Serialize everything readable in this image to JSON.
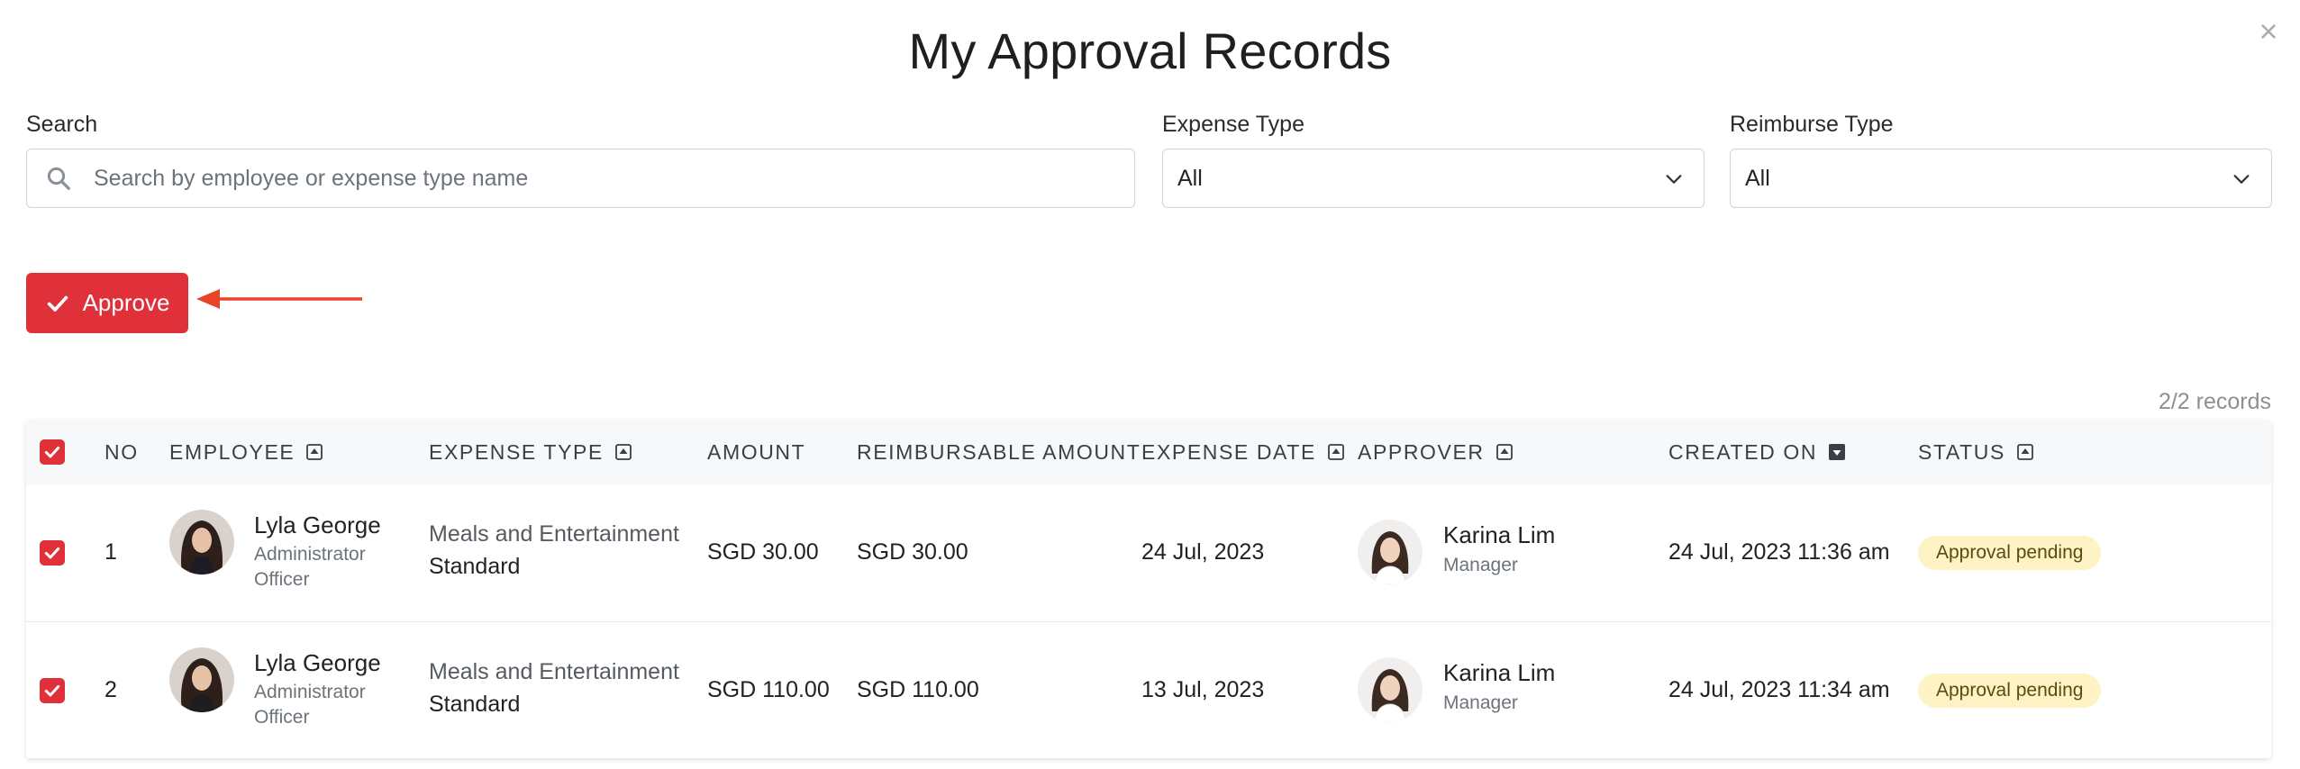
{
  "page": {
    "title": "My Approval Records",
    "close_icon": "close-icon"
  },
  "filters": {
    "search_label": "Search",
    "search_placeholder": "Search by employee or expense type name",
    "search_value": "",
    "expense_type_label": "Expense Type",
    "expense_type_value": "All",
    "reimburse_type_label": "Reimburse Type",
    "reimburse_type_value": "All"
  },
  "toolbar": {
    "approve_label": "Approve",
    "records_count": "2/2 records"
  },
  "table": {
    "headers": {
      "no": "NO",
      "employee": "EMPLOYEE",
      "expense_type": "EXPENSE TYPE",
      "amount": "AMOUNT",
      "reimbursable_amount": "REIMBURSABLE AMOUNT",
      "expense_date": "EXPENSE DATE",
      "approver": "APPROVER",
      "created_on": "CREATED ON",
      "status": "STATUS"
    },
    "select_all_checked": true,
    "rows": [
      {
        "checked": true,
        "no": "1",
        "employee_name": "Lyla George",
        "employee_role_line1": "Administrator",
        "employee_role_line2": "Officer",
        "expense_type": "Meals and Entertainment",
        "expense_subtype": "Standard",
        "amount": "SGD 30.00",
        "reimbursable_amount": "SGD 30.00",
        "expense_date": "24 Jul, 2023",
        "approver_name": "Karina Lim",
        "approver_role": "Manager",
        "created_on": "24 Jul, 2023 11:36 am",
        "status": "Approval pending"
      },
      {
        "checked": true,
        "no": "2",
        "employee_name": "Lyla George",
        "employee_role_line1": "Administrator",
        "employee_role_line2": "Officer",
        "expense_type": "Meals and Entertainment",
        "expense_subtype": "Standard",
        "amount": "SGD 110.00",
        "reimbursable_amount": "SGD 110.00",
        "expense_date": "13 Jul, 2023",
        "approver_name": "Karina Lim",
        "approver_role": "Manager",
        "created_on": "24 Jul, 2023 11:34 am",
        "status": "Approval pending"
      }
    ]
  },
  "colors": {
    "accent": "#e0313b",
    "status_pending_bg": "#fdf3c4",
    "annotation_arrow": "#e8442a"
  }
}
